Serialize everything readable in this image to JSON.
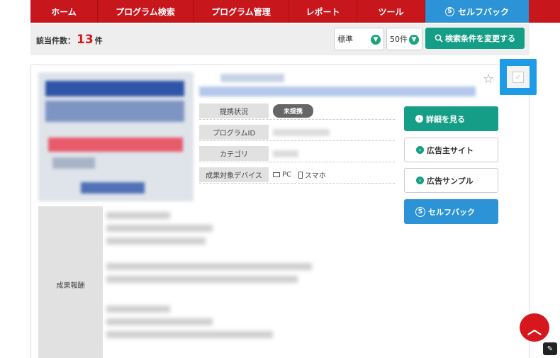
{
  "nav": {
    "items": [
      {
        "label": "ホーム"
      },
      {
        "label": "プログラム検索"
      },
      {
        "label": "プログラム管理"
      },
      {
        "label": "レポート"
      },
      {
        "label": "ツール"
      },
      {
        "label": "セルフバック",
        "icon": "selfback-icon",
        "active": true
      }
    ]
  },
  "toolbar": {
    "count_prefix": "該当件数：",
    "count": "13",
    "count_suffix": "件",
    "sort_value": "標準",
    "per_page_value": "50件",
    "search_button": "検索条件を変更する"
  },
  "card": {
    "info": [
      {
        "label": "提携状況",
        "value": "未提携"
      },
      {
        "label": "プログラムID"
      },
      {
        "label": "カテゴリ"
      },
      {
        "label": "成果対象デバイス",
        "pc": "PC",
        "sp": "スマホ"
      }
    ],
    "buttons": {
      "detail": "詳細を見る",
      "advertiser": "広告主サイト",
      "sample": "広告サンプル",
      "selfback": "セルフバック"
    },
    "reward_label": "成果報酬"
  },
  "colors": {
    "nav_red": "#c8161d",
    "active_blue": "#2b93d6",
    "green": "#159e87",
    "count_red": "#d7171e"
  }
}
